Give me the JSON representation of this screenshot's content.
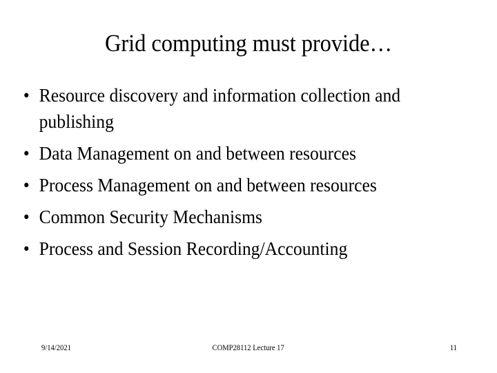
{
  "slide": {
    "title": "Grid computing must provide…",
    "bullet_marker": "•",
    "bullets": [
      {
        "text": "Resource discovery and information collection and publishing"
      },
      {
        "text": "Data Management on and between resources"
      },
      {
        "text": "Process Management on and between resources"
      },
      {
        "text": "Common Security Mechanisms"
      },
      {
        "text": "Process and Session Recording/Accounting"
      }
    ],
    "footer": {
      "date": "9/14/2021",
      "center": "COMP28112 Lecture 17",
      "page_number": "11"
    },
    "colors": {
      "background": "#ffffff",
      "text": "#000000"
    }
  }
}
